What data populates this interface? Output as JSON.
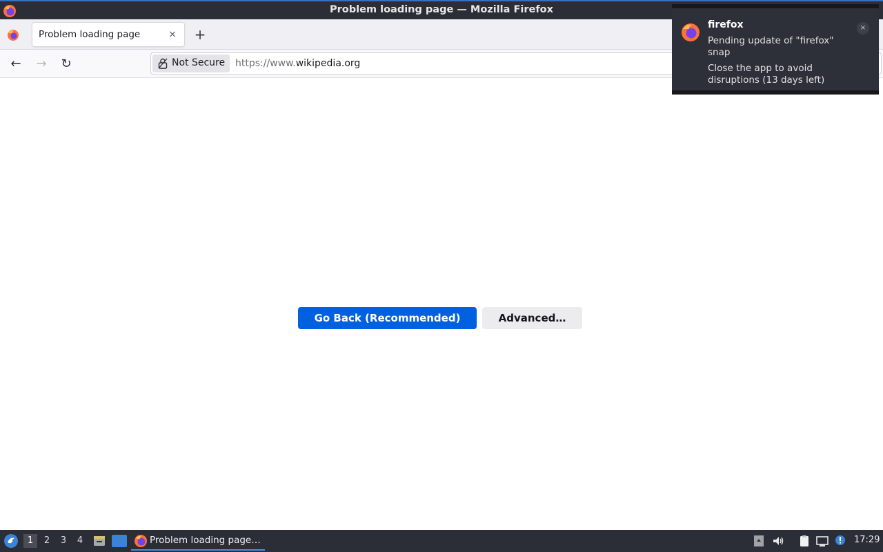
{
  "window": {
    "title": "Problem loading page — Mozilla Firefox"
  },
  "tabs": [
    {
      "label": "Problem loading page",
      "close": "×"
    }
  ],
  "new_tab_label": "+",
  "nav": {
    "back": "←",
    "forward": "→",
    "reload": "↻",
    "security_label": "Not Secure",
    "url_prefix": "https://www.",
    "url_domain": "wikipedia.org"
  },
  "content": {
    "primary_button": "Go Back (Recommended)",
    "secondary_button": "Advanced…"
  },
  "notification": {
    "app": "firefox",
    "message": "Pending update of \"firefox\" snap",
    "detail": "Close the app to avoid disruptions (13 days left)",
    "close": "×"
  },
  "taskbar": {
    "workspaces": [
      "1",
      "2",
      "3",
      "4"
    ],
    "active_workspace": "1",
    "task_label": "Problem loading page…",
    "clock": "17:29"
  },
  "colors": {
    "accent": "#0061e0",
    "titlebar": "#2b2e37",
    "taskbar_indicator": "#4a8fe7"
  }
}
